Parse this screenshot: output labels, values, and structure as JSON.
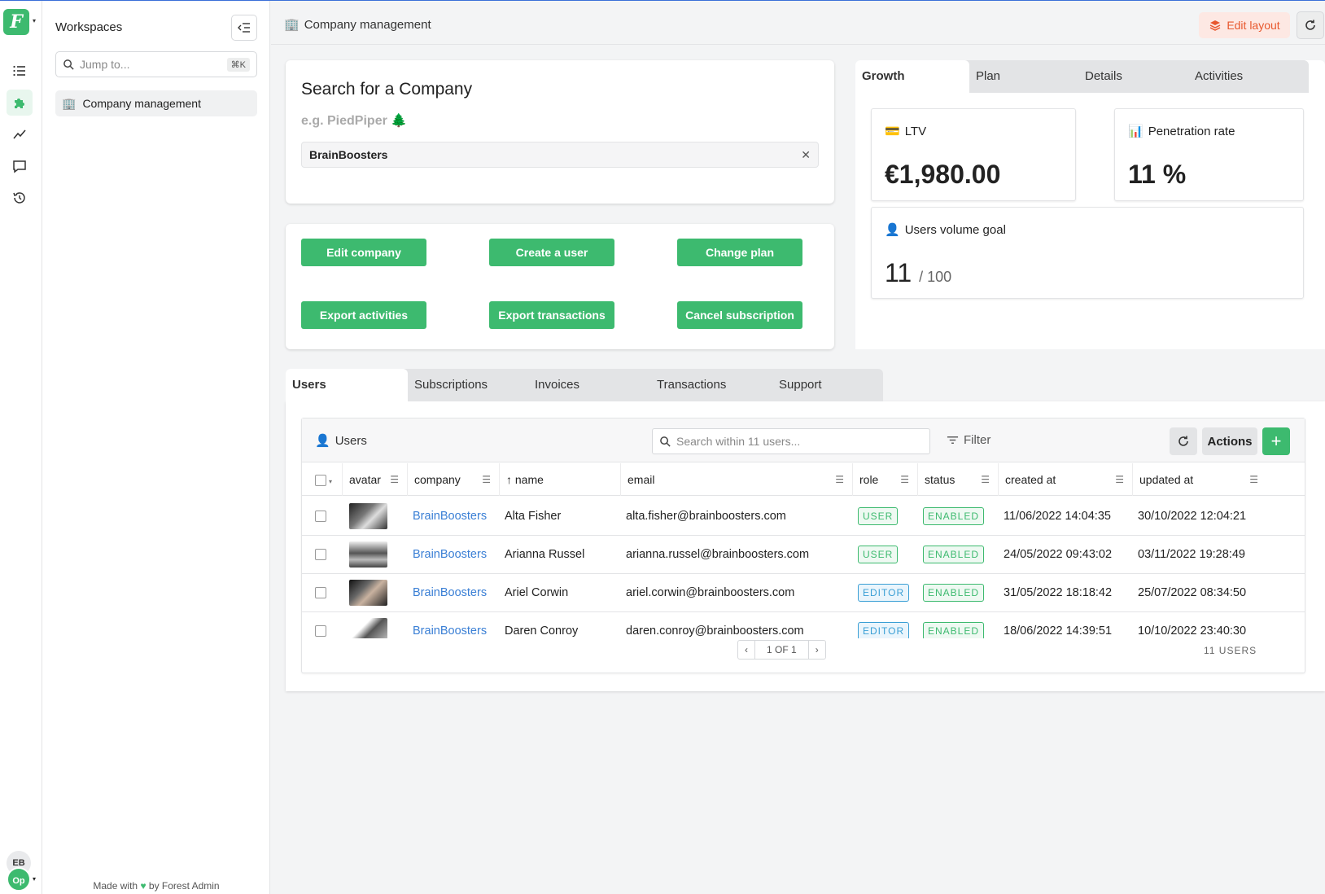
{
  "app": {
    "logo_letter": "F",
    "brand_color": "#3dba6f"
  },
  "user_avatars": {
    "primary": "EB",
    "secondary": "Op"
  },
  "workspaces": {
    "title": "Workspaces",
    "jump_placeholder": "Jump to...",
    "jump_shortcut": "⌘K",
    "items": [
      {
        "label": "Company management"
      }
    ],
    "footer_prefix": "Made with",
    "footer_suffix": "by Forest Admin"
  },
  "topbar": {
    "breadcrumb": "Company management",
    "edit_layout_label": "Edit layout",
    "edit_layout_color": "#e8582e"
  },
  "search_widget": {
    "title": "Search for a Company",
    "hint": "e.g. PiedPiper 🌲",
    "value": "BrainBoosters"
  },
  "action_buttons": [
    "Edit company",
    "Create a user",
    "Change plan",
    "Export activities",
    "Export transactions",
    "Cancel subscription"
  ],
  "growth": {
    "tabs": [
      "Growth",
      "Plan",
      "Details",
      "Activities"
    ],
    "ltv": {
      "label": "LTV",
      "value": "€1,980.00"
    },
    "penetration": {
      "label": "Penetration rate",
      "value": "11 %"
    },
    "users_goal": {
      "label": "Users volume goal",
      "value": "11",
      "goal": "/ 100"
    }
  },
  "data_tabs": [
    "Users",
    "Subscriptions",
    "Invoices",
    "Transactions",
    "Support"
  ],
  "users_table": {
    "title": "Users",
    "search_placeholder": "Search within 11 users...",
    "filter_label": "Filter",
    "actions_label": "Actions",
    "add_label": "+",
    "columns": [
      "avatar",
      "company",
      "name",
      "email",
      "role",
      "status",
      "created at",
      "updated at"
    ],
    "rows": [
      {
        "company": "BrainBoosters",
        "name": "Alta Fisher",
        "email": "alta.fisher@brainboosters.com",
        "role": "USER",
        "status": "ENABLED",
        "created_at": "11/06/2022 14:04:35",
        "updated_at": "30/10/2022 12:04:21"
      },
      {
        "company": "BrainBoosters",
        "name": "Arianna Russel",
        "email": "arianna.russel@brainboosters.com",
        "role": "USER",
        "status": "ENABLED",
        "created_at": "24/05/2022 09:43:02",
        "updated_at": "03/11/2022 19:28:49"
      },
      {
        "company": "BrainBoosters",
        "name": "Ariel Corwin",
        "email": "ariel.corwin@brainboosters.com",
        "role": "EDITOR",
        "status": "ENABLED",
        "created_at": "31/05/2022 18:18:42",
        "updated_at": "25/07/2022 08:34:50"
      },
      {
        "company": "BrainBoosters",
        "name": "Daren Conroy",
        "email": "daren.conroy@brainboosters.com",
        "role": "EDITOR",
        "status": "ENABLED",
        "created_at": "18/06/2022 14:39:51",
        "updated_at": "10/10/2022 23:40:30"
      }
    ],
    "pagination": "1 OF 1",
    "total": "11 USERS"
  }
}
